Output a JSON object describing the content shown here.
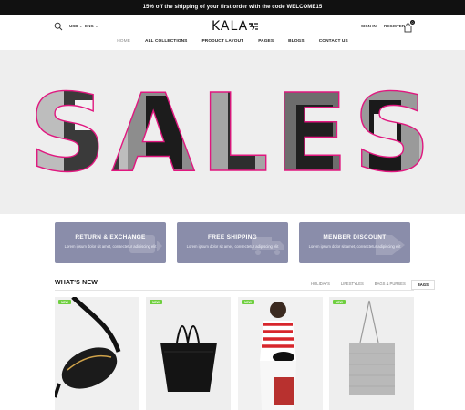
{
  "promo": "15% off the shipping of your first order with the code WELCOME15",
  "header": {
    "currency": "USD",
    "language": "ENG",
    "logo": "KALA",
    "sign_in": "SIGN IN",
    "register": "REGISTER",
    "cart_count": "0"
  },
  "nav": [
    "HOME",
    "ALL COLLECTIONS",
    "PRODUCT LAYOUT",
    "PAGES",
    "BLOGS",
    "CONTACT US"
  ],
  "hero": {
    "headline": "SALES",
    "slide_dots": 3,
    "active_slide": 1
  },
  "features": [
    {
      "title": "RETURN & EXCHANGE",
      "text": "Lorem ipsum dolor sit amet, consectetur adipiscing elit"
    },
    {
      "title": "FREE SHIPPING",
      "text": "Lorem ipsum dolor sit amet, consectetur adipiscing elit"
    },
    {
      "title": "MEMBER DISCOUNT",
      "text": "Lorem ipsum dolor sit amet, consectetur adipiscing elit"
    }
  ],
  "whats_new": {
    "title": "WHAT'S NEW",
    "tabs": [
      "HOLIDAYS",
      "LIFESTYLES",
      "BAGS & PURSES",
      "BAGS"
    ],
    "active_tab": "BAGS"
  },
  "products": [
    {
      "badge": "NEW",
      "icon": "belt-bag-icon"
    },
    {
      "badge": "NEW",
      "icon": "tote-bag-icon"
    },
    {
      "badge": "NEW",
      "icon": "model-photo-icon"
    },
    {
      "badge": "NEW",
      "icon": "silver-tote-icon"
    }
  ],
  "colors": {
    "accent": "#e0177f",
    "feature_bg": "#8a8daa",
    "badge": "#6fcf3f"
  }
}
